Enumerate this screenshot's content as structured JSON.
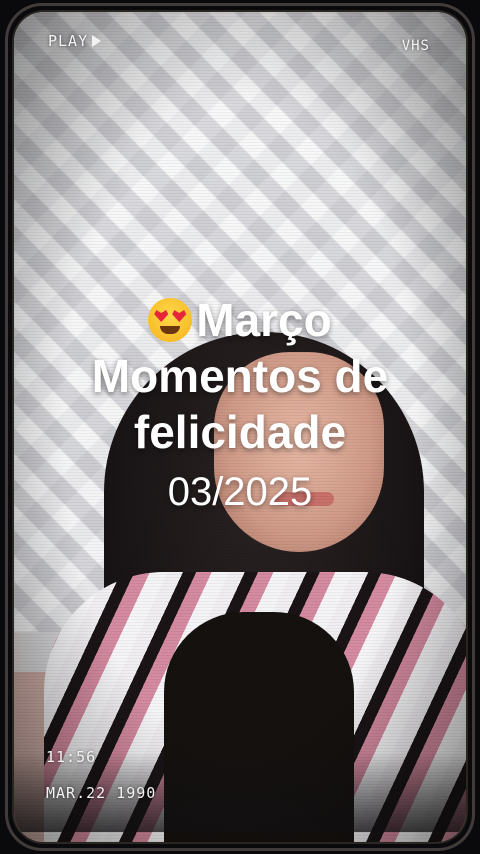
{
  "osd": {
    "play_label": "PLAY",
    "format_label": "VHS",
    "time": "11:56",
    "date": "MAR.22 1990"
  },
  "caption": {
    "emoji_icon": "heart-eyes-emoji",
    "line1": "Março",
    "line2": "Momentos de",
    "line3": "felicidade",
    "date_line": "03/2025"
  }
}
